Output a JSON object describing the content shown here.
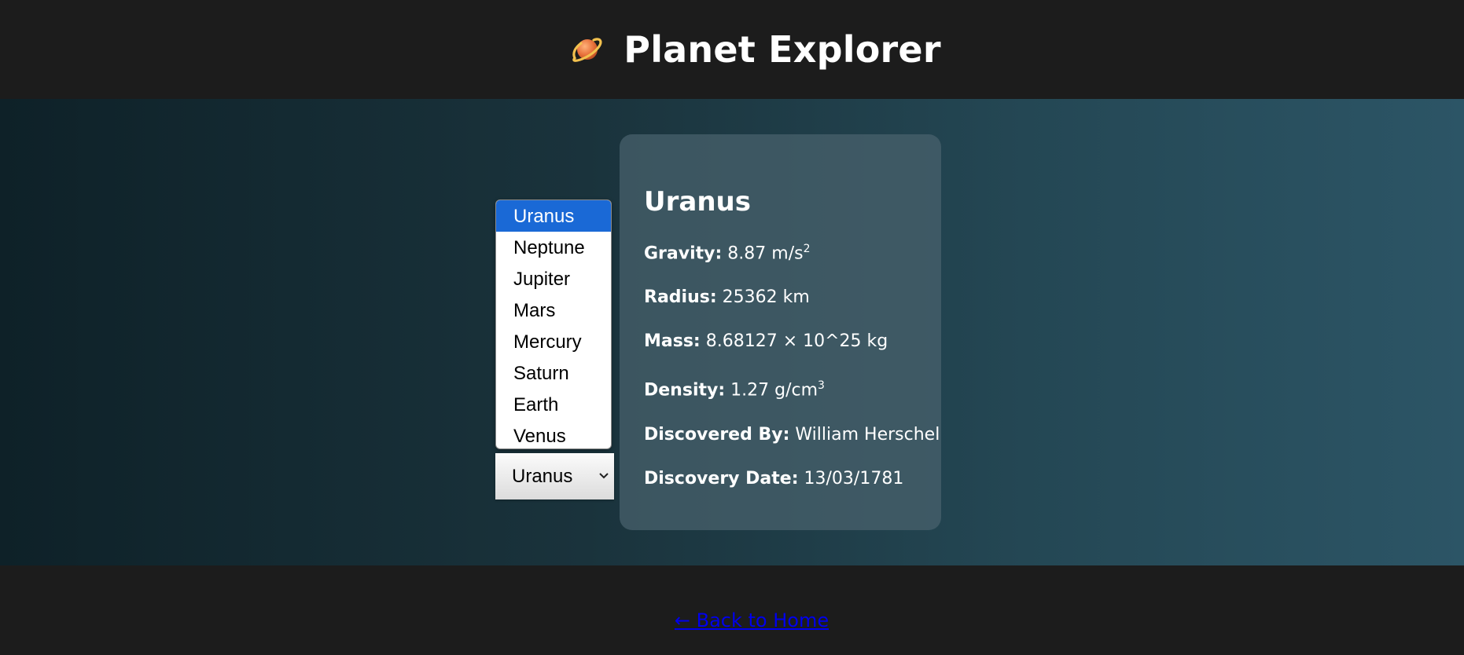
{
  "header": {
    "title": "Planet Explorer",
    "icon": "ringed-planet-icon"
  },
  "planet_select": {
    "selected": "Uranus",
    "options": [
      "Uranus",
      "Neptune",
      "Jupiter",
      "Mars",
      "Mercury",
      "Saturn",
      "Earth",
      "Venus"
    ]
  },
  "planet_info": {
    "name": "Uranus",
    "gravity_label": "Gravity:",
    "gravity_value": "8.87 m/s",
    "gravity_sup": "2",
    "radius_label": "Radius:",
    "radius_value": "25362 km",
    "mass_label": "Mass:",
    "mass_value": "8.68127 × 10^25 kg",
    "density_label": "Density:",
    "density_value": "1.27 g/cm",
    "density_sup": "3",
    "discovered_by_label": "Discovered By:",
    "discovered_by_value": "William Herschel",
    "discovery_date_label": "Discovery Date:",
    "discovery_date_value": "13/03/1781"
  },
  "footer": {
    "back_link": "← Back to Home"
  },
  "colors": {
    "header_bg": "#1c1c1c",
    "selected_option": "#1a69d6",
    "link": "#0000ee"
  }
}
